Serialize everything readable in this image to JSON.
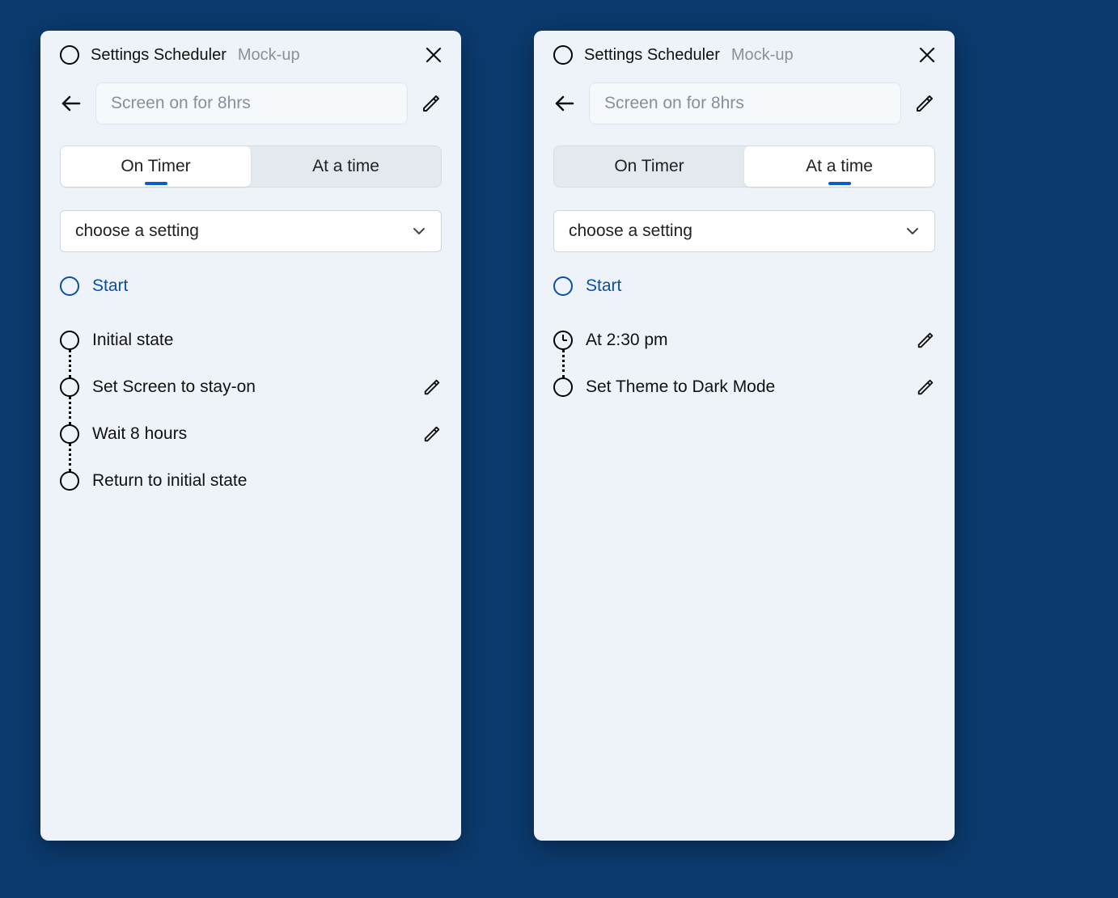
{
  "left": {
    "titlebar": {
      "title": "Settings Scheduler",
      "subtitle": "Mock-up"
    },
    "name_placeholder": "Screen on for 8hrs",
    "tabs": {
      "on_timer": "On Timer",
      "at_a_time": "At a time",
      "active": "on_timer"
    },
    "select_placeholder": "choose a setting",
    "start_label": "Start",
    "steps": [
      {
        "label": "Initial state",
        "editable": false,
        "icon": "circle"
      },
      {
        "label": "Set Screen to stay-on",
        "editable": true,
        "icon": "circle"
      },
      {
        "label": "Wait 8 hours",
        "editable": true,
        "icon": "circle"
      },
      {
        "label": "Return to initial state",
        "editable": false,
        "icon": "circle"
      }
    ]
  },
  "right": {
    "titlebar": {
      "title": "Settings Scheduler",
      "subtitle": "Mock-up"
    },
    "name_placeholder": "Screen on for 8hrs",
    "tabs": {
      "on_timer": "On Timer",
      "at_a_time": "At a time",
      "active": "at_a_time"
    },
    "select_placeholder": "choose a setting",
    "start_label": "Start",
    "steps": [
      {
        "label": "At 2:30 pm",
        "editable": true,
        "icon": "clock"
      },
      {
        "label": "Set Theme to Dark Mode",
        "editable": true,
        "icon": "circle"
      }
    ]
  }
}
